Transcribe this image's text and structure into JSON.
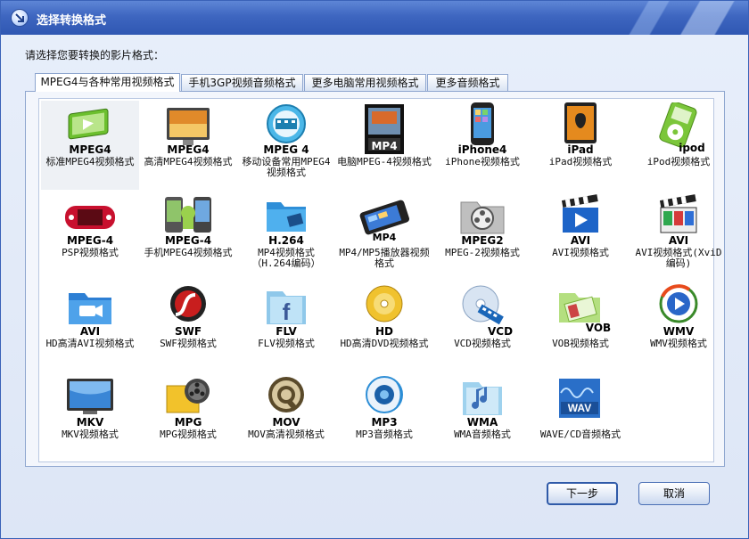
{
  "window": {
    "title": "选择转换格式"
  },
  "prompt": "请选择您要转换的影片格式：",
  "tabs": [
    {
      "label": "MPEG4与各种常用视频格式",
      "active": true
    },
    {
      "label": "手机3GP视频音频格式",
      "active": false
    },
    {
      "label": "更多电脑常用视频格式",
      "active": false
    },
    {
      "label": "更多音频格式",
      "active": false
    }
  ],
  "formats": [
    {
      "icon": "video-player-icon",
      "format": "MPEG4",
      "desc": "标准MPEG4视频格式",
      "selected": true
    },
    {
      "icon": "monitor-icon",
      "format": "MPEG4",
      "desc": "高清MPEG4视频格式"
    },
    {
      "icon": "film-ball-icon",
      "format": "MPEG 4",
      "desc": "移动设备常用MPEG4视频格式"
    },
    {
      "icon": "film-box-icon",
      "format": "MP4",
      "desc": "电脑MPEG-4视频格式"
    },
    {
      "icon": "iphone-icon",
      "format": "iPhone4",
      "desc": "iPhone视频格式"
    },
    {
      "icon": "ipad-icon",
      "format": "iPad",
      "desc": "iPad视频格式"
    },
    {
      "icon": "ipod-icon",
      "format": "ipod",
      "desc": "iPod视频格式"
    },
    {
      "icon": "psp-icon",
      "format": "MPEG-4",
      "desc": "PSP视频格式"
    },
    {
      "icon": "mobile-phones-icon",
      "format": "MPEG-4",
      "desc": "手机MPEG4视频格式"
    },
    {
      "icon": "folder-icon",
      "format": "H.264",
      "desc": "MP4视频格式（H.264编码）"
    },
    {
      "icon": "mp4-player-icon",
      "format": "MP4",
      "desc": "MP4/MP5播放器视频格式"
    },
    {
      "icon": "film-reel-folder-icon",
      "format": "MPEG2",
      "desc": "MPEG-2视频格式"
    },
    {
      "icon": "clapperboard-icon",
      "format": "AVI",
      "desc": "AVI视频格式"
    },
    {
      "icon": "k-lite-clapper-icon",
      "format": "AVI",
      "desc": "AVI视频格式(XviD编码)"
    },
    {
      "icon": "video-camera-folder-icon",
      "format": "AVI",
      "desc": "HD高清AVI视频格式"
    },
    {
      "icon": "swf-icon",
      "format": "SWF",
      "desc": "SWF视频格式"
    },
    {
      "icon": "facebook-folder-icon",
      "format": "FLV",
      "desc": "FLV视频格式"
    },
    {
      "icon": "gold-disc-icon",
      "format": "HD",
      "desc": "HD高清DVD视频格式"
    },
    {
      "icon": "cd-film-icon",
      "format": "VCD",
      "desc": "VCD视频格式"
    },
    {
      "icon": "vob-folder-icon",
      "format": "VOB",
      "desc": "VOB视频格式"
    },
    {
      "icon": "wmv-play-icon",
      "format": "WMV",
      "desc": "WMV视频格式"
    },
    {
      "icon": "tv-icon",
      "format": "MKV",
      "desc": "MKV视频格式"
    },
    {
      "icon": "mpg-film-icon",
      "format": "MPG",
      "desc": "MPG视频格式"
    },
    {
      "icon": "quicktime-icon",
      "format": "MOV",
      "desc": "MOV高清视频格式"
    },
    {
      "icon": "mp3-speaker-icon",
      "format": "MP3",
      "desc": "MP3音频格式"
    },
    {
      "icon": "music-folder-icon",
      "format": "WMA",
      "desc": "WMA音频格式"
    },
    {
      "icon": "wav-wave-icon",
      "format": "",
      "desc": "WAVE/CD音频格式"
    }
  ],
  "wav_icon_label": "WAV",
  "buttons": {
    "next": "下一步",
    "cancel": "取消"
  }
}
